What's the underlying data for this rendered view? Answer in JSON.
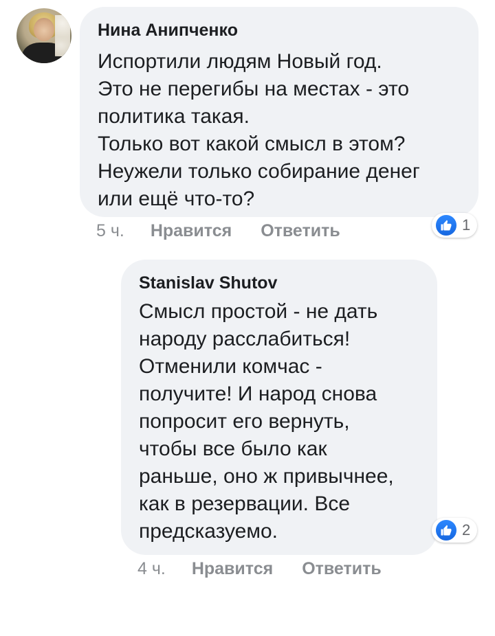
{
  "comments": [
    {
      "author": "Нина Анипченко",
      "text": "Испортили людям Новый год.\nЭто не перегибы на местах - это\nполитика такая.\nТолько вот какой смысл в этом?\nНеужели только собирание денег\nили ещё что-то?",
      "time": "5 ч.",
      "like_label": "Нравится",
      "reply_label": "Ответить",
      "reaction_count": "1"
    },
    {
      "author": "Stanislav Shutov",
      "text": "Смысл простой - не дать\nнароду расслабиться!\nОтменили комчас -\nполучите!  И народ снова\nпопросит его вернуть,\nчтобы все было как\nраньше, оно ж привычнее,\nкак в резервации. Все\nпредсказуемо.",
      "time": "4 ч.",
      "like_label": "Нравится",
      "reply_label": "Ответить",
      "reaction_count": "2"
    }
  ],
  "colors": {
    "bubble": "#f0f2f5",
    "meta_text": "#8a8d91",
    "like_blue": "#1877f2"
  },
  "icons": {
    "reaction": "thumbs-up-icon",
    "avatar": "user-avatar"
  }
}
